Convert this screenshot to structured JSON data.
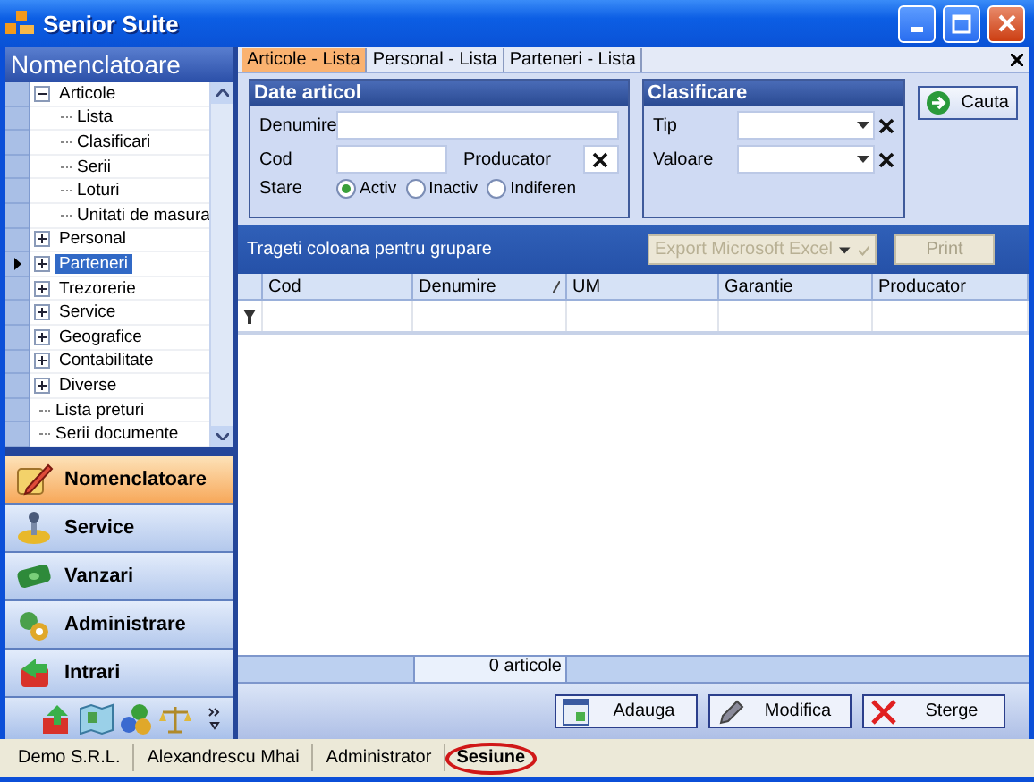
{
  "window": {
    "title": "Senior Suite"
  },
  "sidebar": {
    "title": "Nomenclatoare",
    "tree": [
      {
        "label": "Articole",
        "expanded": true,
        "selected": false,
        "children": [
          {
            "label": "Lista",
            "selected": false
          },
          {
            "label": "Clasificari",
            "selected": false
          },
          {
            "label": "Serii",
            "selected": false
          },
          {
            "label": "Loturi",
            "selected": false
          },
          {
            "label": "Unitati de masura",
            "selected": false
          }
        ]
      },
      {
        "label": "Personal",
        "expanded": false,
        "selected": false
      },
      {
        "label": "Parteneri",
        "expanded": false,
        "selected": true
      },
      {
        "label": "Trezorerie",
        "expanded": false,
        "selected": false
      },
      {
        "label": "Service",
        "expanded": false,
        "selected": false
      },
      {
        "label": "Geografice",
        "expanded": false,
        "selected": false
      },
      {
        "label": "Contabilitate",
        "expanded": false,
        "selected": false
      },
      {
        "label": "Diverse",
        "expanded": false,
        "selected": false
      },
      {
        "label": "Lista preturi",
        "selected": false
      },
      {
        "label": "Serii documente",
        "selected": false
      }
    ],
    "nav": [
      {
        "label": "Nomenclatoare",
        "kind": "catalog",
        "selected": true
      },
      {
        "label": "Service",
        "kind": "service",
        "selected": false
      },
      {
        "label": "Vanzari",
        "kind": "money",
        "selected": false
      },
      {
        "label": "Administrare",
        "kind": "admin",
        "selected": false
      },
      {
        "label": "Intrari",
        "kind": "inbound",
        "selected": false
      }
    ]
  },
  "tabs": [
    {
      "label": "Articole - Lista",
      "selected": true
    },
    {
      "label": "Personal - Lista",
      "selected": false
    },
    {
      "label": "Parteneri - Lista",
      "selected": false
    }
  ],
  "filters": {
    "date_articol": {
      "title": "Date articol",
      "denumire_label": "Denumire",
      "cod_label": "Cod",
      "producator_label": "Producator",
      "stare_label": "Stare",
      "stare_options": [
        {
          "label": "Activ",
          "selected": true
        },
        {
          "label": "Inactiv",
          "selected": false
        },
        {
          "label": "Indiferen",
          "selected": false
        }
      ]
    },
    "clasificare": {
      "title": "Clasificare",
      "fields": [
        {
          "label": "Tip"
        },
        {
          "label": "Valoare"
        }
      ]
    },
    "search_button": "Cauta"
  },
  "grid": {
    "group_hint": "Trageti coloana pentru grupare",
    "export_combo": {
      "value": "Export Microsoft Excel",
      "disabled": true
    },
    "print_button": {
      "label": "Print",
      "disabled": true
    },
    "columns": [
      {
        "label": "Cod",
        "sorted": false
      },
      {
        "label": "Denumire",
        "sorted": true
      },
      {
        "label": "UM",
        "sorted": false
      },
      {
        "label": "Garantie",
        "sorted": false
      },
      {
        "label": "Producator",
        "sorted": false
      }
    ],
    "count": "0 articole"
  },
  "actions": [
    {
      "label": "Adauga",
      "kind": "add"
    },
    {
      "label": "Modifica",
      "kind": "edit"
    },
    {
      "label": "Sterge",
      "kind": "delete"
    }
  ],
  "status_bar": [
    {
      "text": "Demo S.R.L.",
      "highlighted": false
    },
    {
      "text": "Alexandrescu Mhai",
      "highlighted": false
    },
    {
      "text": "Administrator",
      "highlighted": false
    },
    {
      "text": "Sesiune",
      "highlighted": true
    }
  ]
}
